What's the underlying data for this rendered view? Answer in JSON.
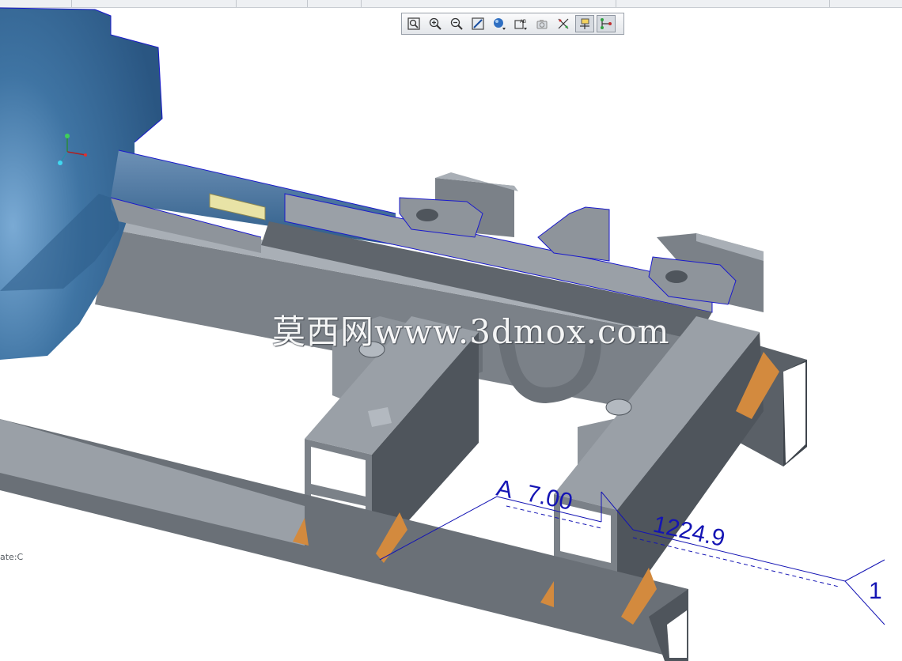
{
  "toolbar": {
    "buttons": [
      {
        "icon": "zoom-fit-icon",
        "active": false
      },
      {
        "icon": "zoom-in-icon",
        "active": false
      },
      {
        "icon": "zoom-out-icon",
        "active": false
      },
      {
        "icon": "repaint-icon",
        "active": false
      },
      {
        "icon": "display-style-icon",
        "active": false
      },
      {
        "icon": "annotation-display-icon",
        "active": false
      },
      {
        "icon": "saved-views-icon",
        "active": false
      },
      {
        "icon": "datum-display-icon",
        "active": false
      },
      {
        "icon": "spin-center-icon",
        "active": true
      },
      {
        "icon": "datum-points-icon",
        "active": true
      }
    ]
  },
  "viewport": {
    "state_label": "ate:C",
    "watermark": "莫西网www.3dmox.com",
    "annotations": {
      "datum_tag": "A",
      "dim_small": "7.00",
      "dim_large": "1224.9",
      "edge_digit": "1"
    }
  },
  "colors": {
    "steel": "#8e949b",
    "steel_dark": "#4f555c",
    "steel_light": "#b3b9c0",
    "blue_body": "#3c6d99",
    "outline": "#1a1acc",
    "weld": "#d38a3e",
    "dimension": "#1414b4"
  }
}
